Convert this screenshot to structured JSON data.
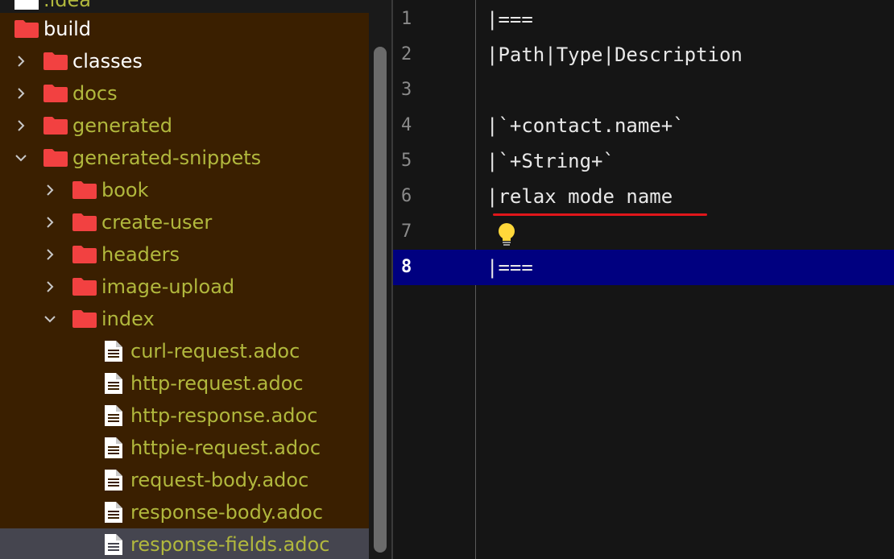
{
  "project_tree": {
    "clipped_item": ".idea",
    "items": [
      {
        "label": "build",
        "type": "folder",
        "expanded": true,
        "level": 0
      },
      {
        "label": "classes",
        "type": "folder",
        "expanded": false,
        "level": 1
      },
      {
        "label": "docs",
        "type": "folder",
        "expanded": false,
        "level": 1
      },
      {
        "label": "generated",
        "type": "folder",
        "expanded": false,
        "level": 1
      },
      {
        "label": "generated-snippets",
        "type": "folder",
        "expanded": true,
        "level": 1
      },
      {
        "label": "book",
        "type": "folder",
        "expanded": false,
        "level": 2
      },
      {
        "label": "create-user",
        "type": "folder",
        "expanded": false,
        "level": 2
      },
      {
        "label": "headers",
        "type": "folder",
        "expanded": false,
        "level": 2
      },
      {
        "label": "image-upload",
        "type": "folder",
        "expanded": false,
        "level": 2
      },
      {
        "label": "index",
        "type": "folder",
        "expanded": true,
        "level": 2
      },
      {
        "label": "curl-request.adoc",
        "type": "file",
        "level": 3
      },
      {
        "label": "http-request.adoc",
        "type": "file",
        "level": 3
      },
      {
        "label": "http-response.adoc",
        "type": "file",
        "level": 3
      },
      {
        "label": "httpie-request.adoc",
        "type": "file",
        "level": 3
      },
      {
        "label": "request-body.adoc",
        "type": "file",
        "level": 3
      },
      {
        "label": "response-body.adoc",
        "type": "file",
        "level": 3
      },
      {
        "label": "response-fields.adoc",
        "type": "file",
        "level": 3,
        "selected": true
      }
    ]
  },
  "editor": {
    "current_line": 8,
    "lines": [
      {
        "no": "1",
        "text": "|==="
      },
      {
        "no": "2",
        "text": "|Path|Type|Description"
      },
      {
        "no": "3",
        "text": ""
      },
      {
        "no": "4",
        "text": "|`+contact.name+`"
      },
      {
        "no": "5",
        "text": "|`+String+`"
      },
      {
        "no": "6",
        "text": "|relax mode name"
      },
      {
        "no": "7",
        "text": ""
      },
      {
        "no": "8",
        "text": "|==="
      }
    ],
    "error_line": 6,
    "intention_bulb_line": 7
  },
  "colors": {
    "tree_background": "#3a1f00",
    "folder_icon": "#f24141",
    "tree_text": "#b1b83d",
    "tree_text_highlight": "#ffffff",
    "selected_row": "#45454f",
    "editor_background": "#151515",
    "current_line": "#000080",
    "error_underline": "#e0161b",
    "bulb": "#ffd83a"
  }
}
